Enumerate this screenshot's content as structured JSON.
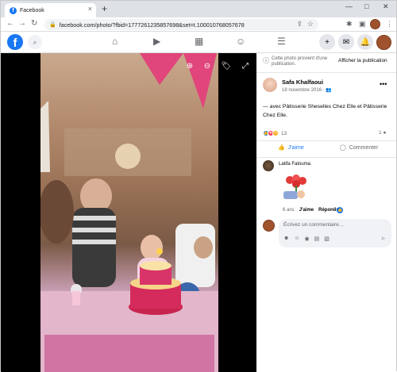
{
  "browser": {
    "tab_title": "Facebook",
    "tab_close": "×",
    "new_tab": "+",
    "min": "—",
    "max": "□",
    "close": "✕",
    "back": "←",
    "forward": "→",
    "reload": "↻",
    "url": "facebook.com/photo/?fbid=1777261235857698&set=t.100010768057678"
  },
  "fb": {
    "logo": "f"
  },
  "sidebar": {
    "info_message": "Cette photo provient d'une publication.",
    "show_post": "Afficher la publication",
    "post": {
      "author": "Safa Khalfaoui",
      "date": "18 novembre 2016 ·",
      "text": "— avec Pâtisserie Sheselles Chez Elle et Pâtisserie Chez Elle.",
      "reaction_count": "13",
      "comment_count": "1",
      "like_label": "J'aime",
      "comment_label": "Commenter"
    },
    "comment": {
      "author": "Latifa Fatouma",
      "time": "6 ans",
      "like": "J'aime",
      "reply": "Répondre",
      "likes": "2"
    },
    "composer": {
      "placeholder": "Écrivez un commentaire…"
    }
  },
  "colors": {
    "accent": "#1877f2",
    "photo_bg": "#000000"
  }
}
